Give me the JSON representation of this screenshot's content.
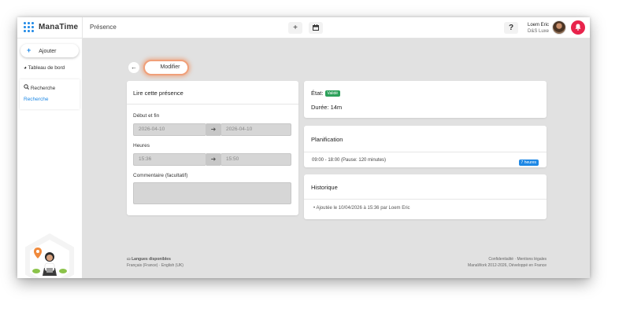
{
  "app": {
    "name": "ManaTime",
    "page_title": "Présence"
  },
  "topbar": {
    "help": "?",
    "user_name": "Loem Eric",
    "company": "D&S Luxe"
  },
  "sidebar": {
    "add_label": "Ajouter",
    "dashboard_label": "Tableau de bord",
    "search_label": "Recherche",
    "search_link": "Recherche"
  },
  "toolbar": {
    "modify_label": "Modifier"
  },
  "form": {
    "title": "Lire cette présence",
    "dates_label": "Début et fin",
    "start_date": "2026-04-10",
    "end_date": "2026-04-10",
    "hours_label": "Heures",
    "start_time": "15:36",
    "end_time": "15:50",
    "comment_label": "Commentaire (facultatif)"
  },
  "status": {
    "state_label": "État:",
    "state_value": "Validé",
    "duration": "Durée: 14m"
  },
  "planning": {
    "title": "Planification",
    "schedule": "09:00 - 18:00  (Pause: 120 minutes)",
    "badge": "7 heures"
  },
  "history": {
    "title": "Historique",
    "entry": "Ajoutée le 10/04/2026 à 15:36 par Loem Eric"
  },
  "footer": {
    "languages_title": "Langues disponibles",
    "languages": "Français (France) · English (UK)",
    "legal": "Confidentialité · Mentions légales",
    "copyright": "ManaWork 2012-2026, Développé en France"
  },
  "colors": {
    "accent": "#1e88e5",
    "success": "#2ca05a",
    "notification": "#e8234b",
    "highlight": "#f0a07a"
  }
}
